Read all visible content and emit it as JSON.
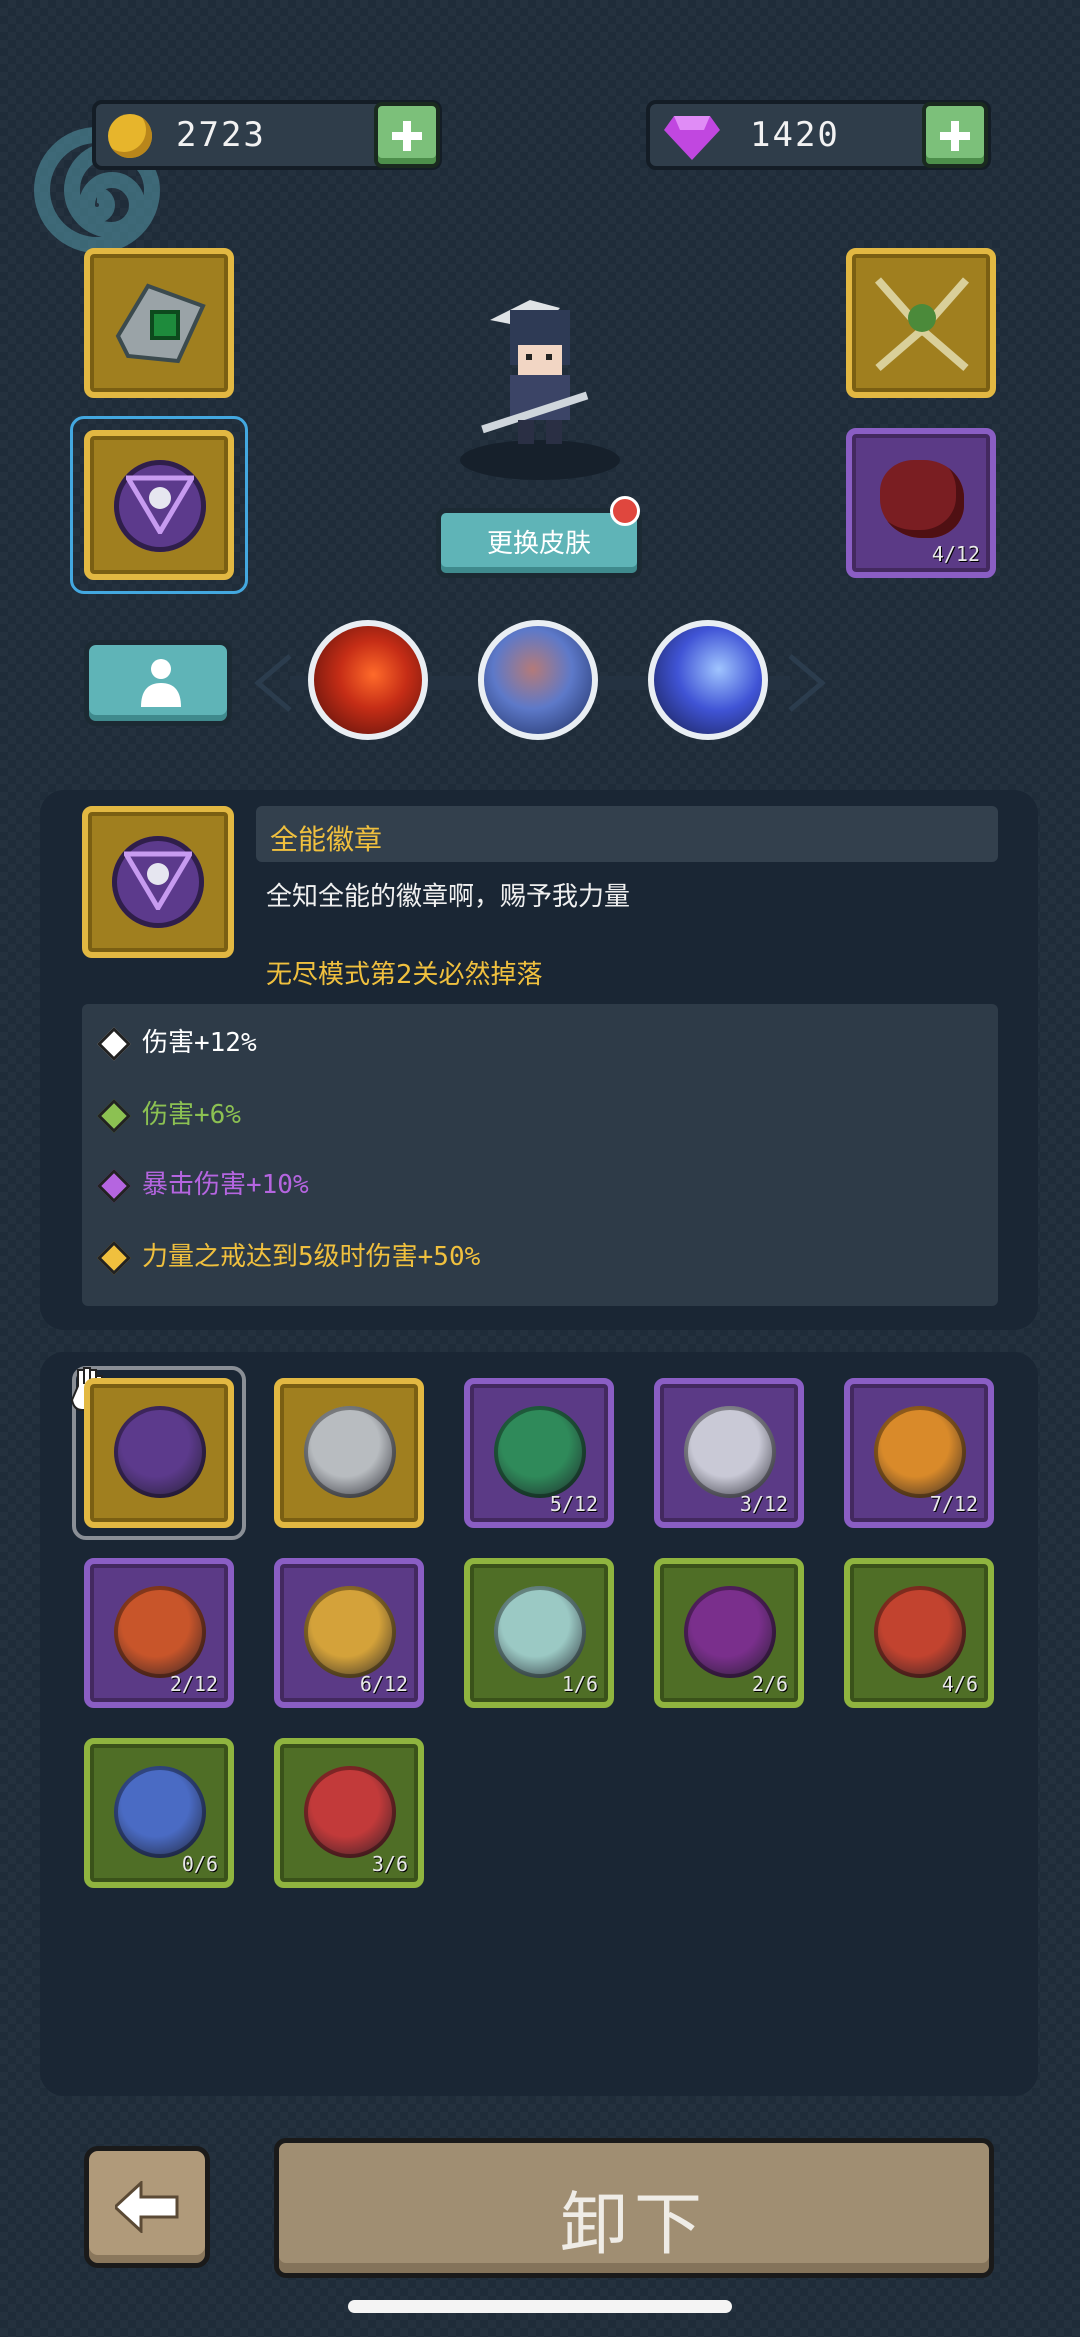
{
  "currency": {
    "gold": "2723",
    "gems": "1420"
  },
  "character": {
    "change_skin_label": "更换皮肤"
  },
  "equipped": {
    "right_bottom_count": "4/12"
  },
  "item_detail": {
    "name": "全能徽章",
    "description": "全知全能的徽章啊，赐予我力量",
    "drop_info": "无尽模式第2关必然掉落",
    "stats": [
      {
        "text": "伤害+12%",
        "color": "#ffffff"
      },
      {
        "text": "伤害+6%",
        "color": "#8cc152"
      },
      {
        "text": "暴击伤害+10%",
        "color": "#b565e0"
      },
      {
        "text": "力量之戒达到5级时伤害+50%",
        "color": "#f0c03e"
      }
    ]
  },
  "inventory": {
    "items": [
      {
        "name": "omni-badge",
        "rarity": "gold",
        "count": ""
      },
      {
        "name": "silver-wheel",
        "rarity": "gold",
        "count": ""
      },
      {
        "name": "emerald-shield",
        "rarity": "purple",
        "count": "5/12"
      },
      {
        "name": "star-badge",
        "rarity": "purple",
        "count": "3/12"
      },
      {
        "name": "orbit-badge",
        "rarity": "purple",
        "count": "7/12"
      },
      {
        "name": "fire-star-badge",
        "rarity": "purple",
        "count": "2/12"
      },
      {
        "name": "gold-star-badge",
        "rarity": "purple",
        "count": "6/12"
      },
      {
        "name": "crystal-frame",
        "rarity": "green",
        "count": "1/6"
      },
      {
        "name": "eye-orb",
        "rarity": "green",
        "count": "2/6"
      },
      {
        "name": "red-target",
        "rarity": "green",
        "count": "4/6"
      },
      {
        "name": "rune-badge",
        "rarity": "green",
        "count": "0/6"
      },
      {
        "name": "demon-badge",
        "rarity": "green",
        "count": "3/6"
      }
    ]
  },
  "footer": {
    "unequip_label": "卸下"
  }
}
